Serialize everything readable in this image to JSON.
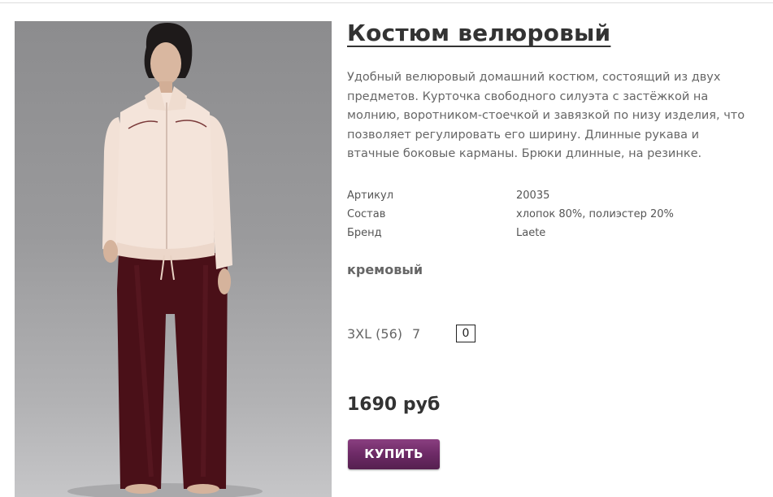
{
  "product": {
    "title": "Костюм велюровый",
    "description": "Удобный велюровый домашний костюм, состоящий из двух предметов. Курточка свободного силуэта с застёжкой на молнию, воротником-стоечкой и завязкой по низу изделия, что позволяет регулировать его ширину. Длинные рукава и втачные боковые карманы. Брюки длинные, на резинке.",
    "specs": [
      {
        "label": "Артикул",
        "value": "20035"
      },
      {
        "label": "Состав",
        "value": "хлопок 80%, полиэстер 20%"
      },
      {
        "label": "Бренд",
        "value": "Laete"
      }
    ],
    "color": "кремовый",
    "sizes": [
      {
        "name": "3XL (56)",
        "stock": "7",
        "quantity": "0"
      }
    ],
    "price": "1690 руб",
    "buy_label": "КУПИТЬ"
  },
  "colors": {
    "buy_button": "#6d2a66",
    "jacket": "#f4e4da",
    "trousers": "#4a1018",
    "background_gray": "#9a9a9c"
  }
}
